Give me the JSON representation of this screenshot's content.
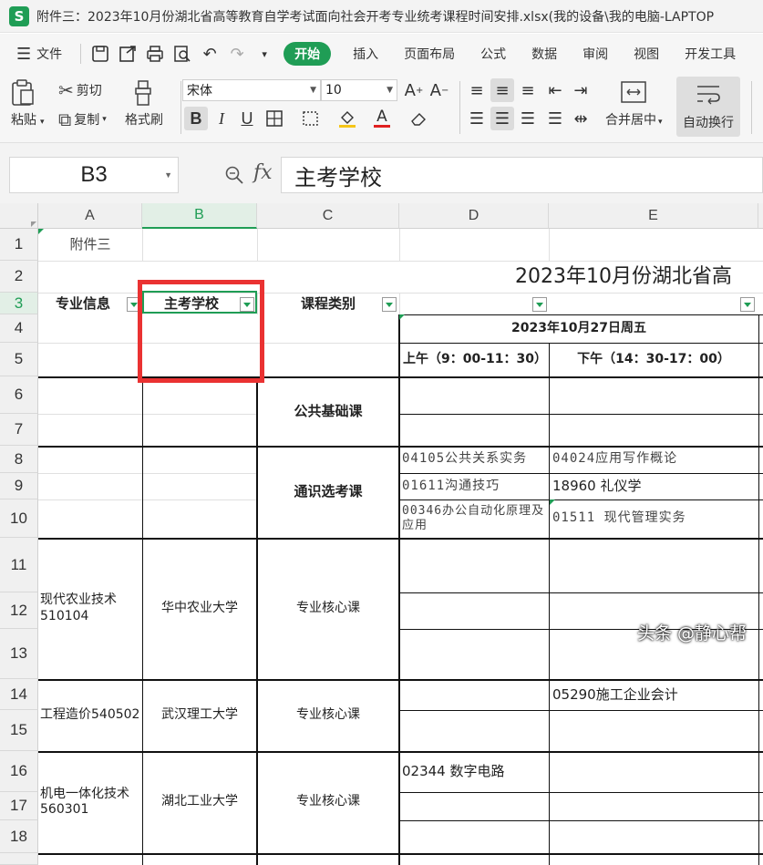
{
  "window": {
    "app_icon": "S",
    "title": "附件三：2023年10月份湖北省高等教育自学考试面向社会开考专业统考课程时间安排.xlsx(我的设备\\我的电脑-LAPTOP"
  },
  "menu": {
    "file_label": "文件",
    "tabs": [
      "开始",
      "插入",
      "页面布局",
      "公式",
      "数据",
      "审阅",
      "视图",
      "开发工具"
    ],
    "active_tab": "开始"
  },
  "ribbon": {
    "paste": "粘贴",
    "cut": "剪切",
    "copy": "复制",
    "format_painter": "格式刷",
    "font_name": "宋体",
    "font_size": "10",
    "merge_center": "合并居中",
    "wrap_text": "自动换行",
    "bold": "B",
    "italic": "I",
    "underline": "U"
  },
  "formula_bar": {
    "cell_ref": "B3",
    "fx": "fx",
    "content": "主考学校"
  },
  "columns": [
    "A",
    "B",
    "C",
    "D",
    "E"
  ],
  "selected_column": "B",
  "rows": [
    "1",
    "2",
    "3",
    "4",
    "5",
    "6",
    "7",
    "8",
    "9",
    "10",
    "11",
    "12",
    "13",
    "14",
    "15",
    "16",
    "17",
    "18"
  ],
  "sheet": {
    "a1": "附件三",
    "title": "2023年10月份湖北省高",
    "h_major": "专业信息",
    "h_school": "主考学校",
    "h_type": "课程类别",
    "date_header": "2023年10月27日周五",
    "am": "上午（9：00-11：30）",
    "pm": "下午（14：30-17：00）",
    "public_basic": "公共基础课",
    "general_elective": "通识选考课",
    "d8": "04105公共关系实务",
    "e8": "04024应用写作概论",
    "d9": "01611沟通技巧",
    "e9": "18960 礼仪学",
    "d10": "00346办公自动化原理及应用",
    "e10": "01511 现代管理实务",
    "major1": "现代农业技术510104",
    "school1": "华中农业大学",
    "major2": "工程造价540502",
    "school2": "武汉理工大学",
    "e14": "05290施工企业会计",
    "major3": "机电一体化技术560301",
    "school3": "湖北工业大学",
    "d16": "02344 数字电路",
    "core": "专业核心课"
  },
  "watermark": "头条 @静心帮"
}
